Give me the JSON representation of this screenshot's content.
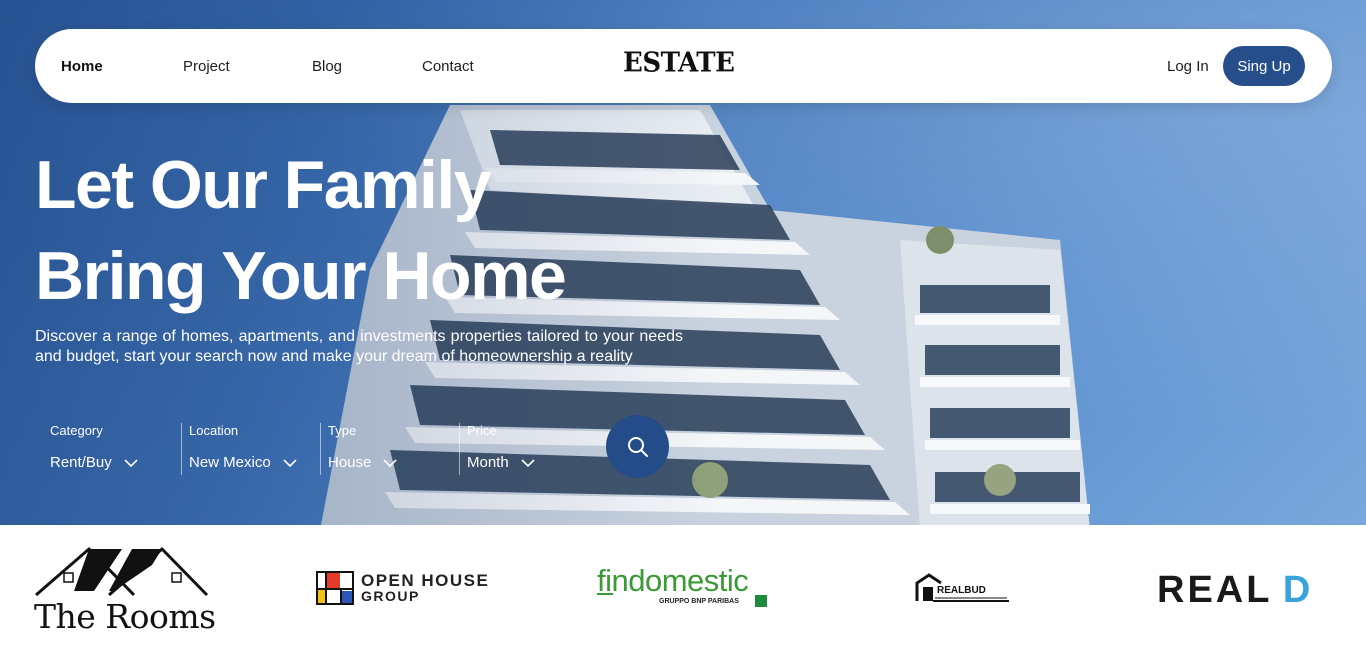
{
  "nav": {
    "links": [
      "Home",
      "Project",
      "Blog",
      "Contact"
    ],
    "logo": "ESTATE",
    "login": "Log In",
    "signup": "Sing Up"
  },
  "hero": {
    "headline_line1": "Let Our Family",
    "headline_line2": "Bring Your Home",
    "description": "Discover a range of homes, apartments, and investments properties tailored to your needs and budget, start your search now and make your dream of homeownership a reality"
  },
  "filters": [
    {
      "label": "Category",
      "value": "Rent/Buy"
    },
    {
      "label": "Location",
      "value": "New Mexico"
    },
    {
      "label": "Type",
      "value": "House"
    },
    {
      "label": "Price",
      "value": "Month"
    }
  ],
  "brands": {
    "rooms": "The Rooms",
    "openhouse_1": "OPEN HOUSE",
    "openhouse_2": "GROUP",
    "findomestic": "findomestic",
    "findomestic_sub": "GRUPPO BNP PARIBAS",
    "realbud": "REALBUD",
    "reald_1": "REAL",
    "reald_2": "D"
  },
  "colors": {
    "accent": "#254e8a",
    "sky": "#3f74b8",
    "findomestic_green": "#3a9a35",
    "reald_blue": "#3aa3de"
  },
  "icons": {
    "search": "search-icon",
    "chevron": "chevron-down-icon"
  }
}
